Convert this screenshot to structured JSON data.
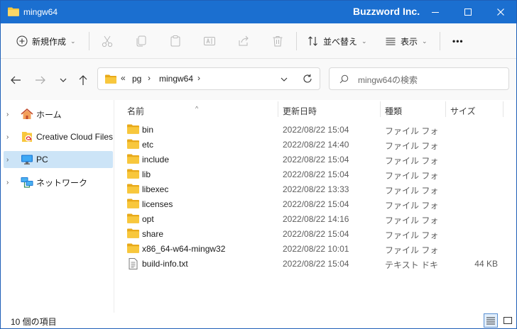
{
  "window": {
    "title": "mingw64",
    "company": "Buzzword Inc.",
    "minimize_icon": "minimize-icon",
    "maximize_icon": "maximize-icon",
    "close_icon": "close-icon"
  },
  "toolbar": {
    "new_label": "新規作成",
    "sort_label": "並べ替え",
    "view_label": "表示",
    "more_label": "•••"
  },
  "address": {
    "overflow": "«",
    "crumbs": [
      "pg",
      "mingw64"
    ],
    "separator": "›"
  },
  "search": {
    "placeholder": "mingw64の検索"
  },
  "sidebar": {
    "items": [
      {
        "label": "ホーム",
        "icon": "home-icon",
        "selected": false
      },
      {
        "label": "Creative Cloud Files",
        "icon": "creative-cloud-icon",
        "selected": false
      },
      {
        "label": "PC",
        "icon": "pc-icon",
        "selected": true
      },
      {
        "label": "ネットワーク",
        "icon": "network-icon",
        "selected": false
      }
    ]
  },
  "columns": {
    "name": "名前",
    "date": "更新日時",
    "type": "種類",
    "size": "サイズ"
  },
  "files": [
    {
      "name": "bin",
      "date": "2022/08/22 15:04",
      "type": "ファイル フォルダー",
      "size": "",
      "kind": "folder"
    },
    {
      "name": "etc",
      "date": "2022/08/22 14:40",
      "type": "ファイル フォルダー",
      "size": "",
      "kind": "folder"
    },
    {
      "name": "include",
      "date": "2022/08/22 15:04",
      "type": "ファイル フォルダー",
      "size": "",
      "kind": "folder"
    },
    {
      "name": "lib",
      "date": "2022/08/22 15:04",
      "type": "ファイル フォルダー",
      "size": "",
      "kind": "folder"
    },
    {
      "name": "libexec",
      "date": "2022/08/22 13:33",
      "type": "ファイル フォルダー",
      "size": "",
      "kind": "folder"
    },
    {
      "name": "licenses",
      "date": "2022/08/22 15:04",
      "type": "ファイル フォルダー",
      "size": "",
      "kind": "folder"
    },
    {
      "name": "opt",
      "date": "2022/08/22 14:16",
      "type": "ファイル フォルダー",
      "size": "",
      "kind": "folder"
    },
    {
      "name": "share",
      "date": "2022/08/22 15:04",
      "type": "ファイル フォルダー",
      "size": "",
      "kind": "folder"
    },
    {
      "name": "x86_64-w64-mingw32",
      "date": "2022/08/22 10:01",
      "type": "ファイル フォルダー",
      "size": "",
      "kind": "folder"
    },
    {
      "name": "build-info.txt",
      "date": "2022/08/22 15:04",
      "type": "テキスト ドキュメント",
      "size": "44 KB",
      "kind": "text"
    }
  ],
  "status": {
    "count": "10 個の項目"
  },
  "colors": {
    "titlebar": "#1b6fd0",
    "folder": "#f8c73c",
    "selection": "#cce4f7"
  }
}
